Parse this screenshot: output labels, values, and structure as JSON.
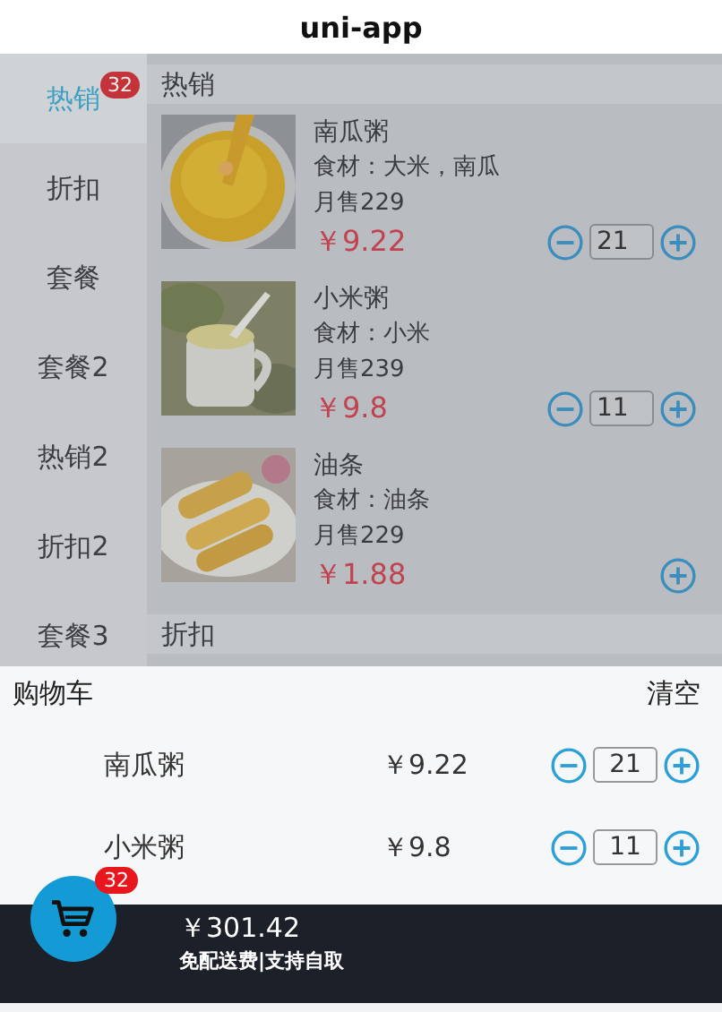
{
  "title": "uni-app",
  "sidebar": {
    "items": [
      {
        "label": "热销",
        "selected": true,
        "badge": "32"
      },
      {
        "label": "折扣",
        "selected": false
      },
      {
        "label": "套餐",
        "selected": false
      },
      {
        "label": "套餐2",
        "selected": false
      },
      {
        "label": "热销2",
        "selected": false
      },
      {
        "label": "折扣2",
        "selected": false
      },
      {
        "label": "套餐3",
        "selected": false
      }
    ]
  },
  "sections": [
    {
      "title": "热销",
      "products": [
        {
          "name": "南瓜粥",
          "ingredients": "食材：大米，南瓜",
          "sales": "月售229",
          "price": "￥9.22",
          "quantity": "21"
        },
        {
          "name": "小米粥",
          "ingredients": "食材：小米",
          "sales": "月售239",
          "price": "￥9.8",
          "quantity": "11"
        },
        {
          "name": "油条",
          "ingredients": "食材：油条",
          "sales": "月售229",
          "price": "￥1.88"
        }
      ]
    },
    {
      "title": "折扣"
    }
  ],
  "cart": {
    "title": "购物车",
    "clear": "清空",
    "items": [
      {
        "name": "南瓜粥",
        "price": "￥9.22",
        "quantity": "21"
      },
      {
        "name": "小米粥",
        "price": "￥9.8",
        "quantity": "11"
      }
    ]
  },
  "footer": {
    "badge": "32",
    "total": "￥301.42",
    "note": "免配送费|支持自取"
  }
}
